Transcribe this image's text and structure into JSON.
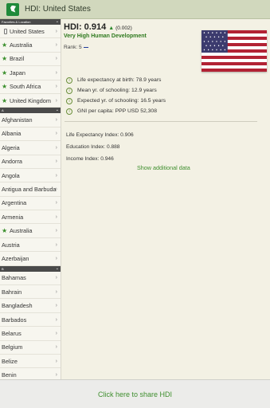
{
  "window": {
    "title": "HDI: United States"
  },
  "sidebar": {
    "favorites_header": "Favorites & Location",
    "favorites": [
      {
        "label": "United States",
        "icon": "phone-icon"
      },
      {
        "label": "Australia",
        "icon": "star-icon"
      },
      {
        "label": "Brazil",
        "icon": "star-icon"
      },
      {
        "label": "Japan",
        "icon": "star-icon"
      },
      {
        "label": "South Africa",
        "icon": "star-icon"
      },
      {
        "label": "United Kingdom",
        "icon": "star-icon"
      }
    ],
    "section_a": "A",
    "a_items": [
      {
        "label": "Afghanistan"
      },
      {
        "label": "Albania"
      },
      {
        "label": "Algeria"
      },
      {
        "label": "Andorra"
      },
      {
        "label": "Angola"
      },
      {
        "label": "Antigua and Barbuda"
      },
      {
        "label": "Argentina"
      },
      {
        "label": "Armenia"
      },
      {
        "label": "Australia",
        "icon": "star-icon"
      },
      {
        "label": "Austria"
      },
      {
        "label": "Azerbaijan"
      }
    ],
    "section_b": "B",
    "b_items": [
      {
        "label": "Bahamas"
      },
      {
        "label": "Bahrain"
      },
      {
        "label": "Bangladesh"
      },
      {
        "label": "Barbados"
      },
      {
        "label": "Belarus"
      },
      {
        "label": "Belgium"
      },
      {
        "label": "Belize"
      },
      {
        "label": "Benin"
      }
    ]
  },
  "main": {
    "hdi_label": "HDI: 0.914",
    "hdi_change": "(0.002)",
    "development": "Very High Human Development",
    "rank_label": "Rank: 5",
    "stats": [
      "Life expectancy at birth: 78.9 years",
      "Mean yr. of schooling: 12.9 years",
      "Expected yr. of schooling: 16.5 years",
      "GNI per capita: PPP USD 52,308"
    ],
    "indexes": [
      "Life Expectancy Index: 0.906",
      "Education Index: 0.888",
      "Income Index: 0.946"
    ],
    "more_link": "Show additional data"
  },
  "footer": {
    "share": "Click here to share HDI"
  },
  "colors": {
    "accent": "#3e8f2e",
    "titlebar": "#d1d8bd",
    "background": "#f3f1e4"
  }
}
